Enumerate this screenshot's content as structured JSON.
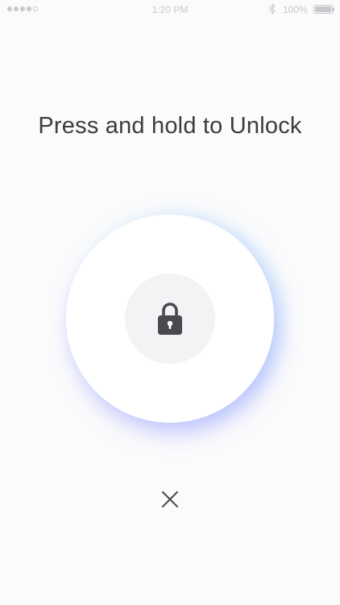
{
  "status_bar": {
    "time": "1:20 PM",
    "battery_percent": "100%",
    "signal_bars_filled": 4,
    "signal_bars_total": 5,
    "bluetooth_icon": "bluetooth-icon",
    "battery_icon": "battery-icon"
  },
  "prompt": {
    "text": "Press and hold to Unlock"
  },
  "unlock": {
    "icon": "lock-icon",
    "accent_glow_colors": [
      "#7878ff",
      "#96d7fa"
    ]
  },
  "close": {
    "icon": "close-icon"
  },
  "colors": {
    "background": "#fbfbfc",
    "text": "#3c3c3f",
    "icon": "#4a4a4e",
    "status": "#c8c8cc"
  }
}
